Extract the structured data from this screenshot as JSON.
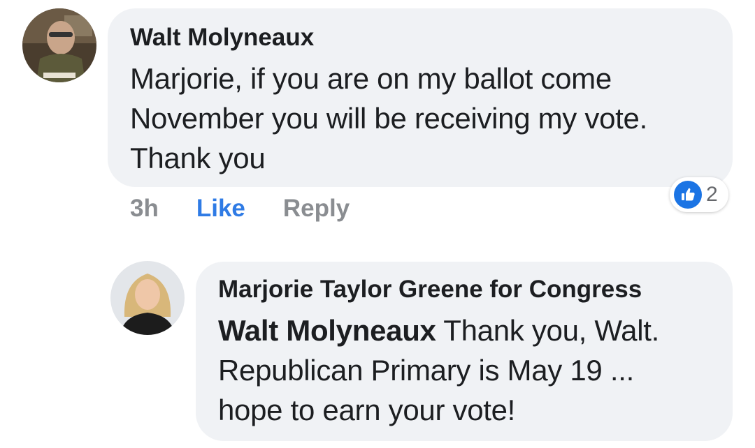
{
  "comment": {
    "author": "Walt Molyneaux",
    "text_lines": [
      "Marjorie, if you are on my ballot come",
      "November you will be receiving my vote.",
      "Thank you"
    ],
    "timestamp": "3h",
    "like_label": "Like",
    "reply_label": "Reply",
    "reaction_count": "2",
    "reaction_icon": "thumbs-up-icon"
  },
  "reply": {
    "author": "Marjorie Taylor Greene for Congress",
    "mention": "Walt Molyneaux",
    "text_line_1": " Thank you, Walt.",
    "text_lines": [
      "Republican Primary is May 19 ...",
      "hope to earn your vote!"
    ]
  },
  "colors": {
    "bubble": "#f0f2f5",
    "link_blue": "#2f7be5",
    "muted": "#8a8d91",
    "like_badge": "#1b74e4"
  }
}
